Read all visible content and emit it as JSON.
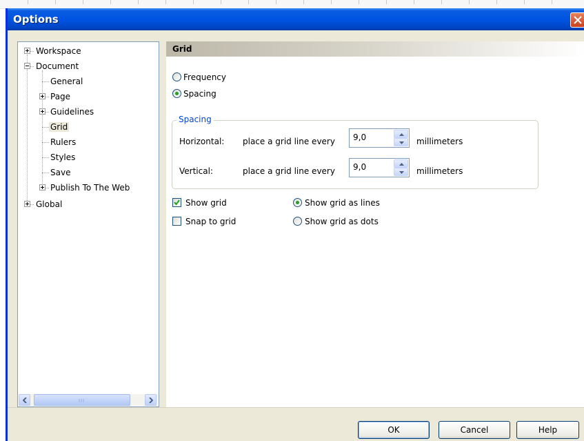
{
  "window": {
    "title": "Options",
    "close_icon": "close-icon"
  },
  "tree": {
    "items": [
      {
        "label": "Workspace",
        "expander": "plus"
      },
      {
        "label": "Document",
        "expander": "minus"
      },
      {
        "label": "General"
      },
      {
        "label": "Page",
        "expander": "plus"
      },
      {
        "label": "Guidelines",
        "expander": "plus"
      },
      {
        "label": "Grid",
        "selected": true
      },
      {
        "label": "Rulers"
      },
      {
        "label": "Styles"
      },
      {
        "label": "Save"
      },
      {
        "label": "Publish To The Web",
        "expander": "plus"
      },
      {
        "label": "Global",
        "expander": "plus"
      }
    ],
    "scrollbar_thumb_grip": "III"
  },
  "panel": {
    "header": "Grid",
    "mode_options": [
      {
        "label": "Frequency",
        "selected": false
      },
      {
        "label": "Spacing",
        "selected": true
      }
    ],
    "spacing_group": {
      "title": "Spacing",
      "rows": [
        {
          "axis": "Horizontal:",
          "text": "place a grid line every",
          "value": "9,0",
          "unit": "millimeters"
        },
        {
          "axis": "Vertical:",
          "text": "place a grid line every",
          "value": "9,0",
          "unit": "millimeters"
        }
      ]
    },
    "show_grid": {
      "label": "Show grid",
      "checked": true
    },
    "snap_to_grid": {
      "label": "Snap to grid",
      "checked": false
    },
    "display_options": [
      {
        "label": "Show grid as lines",
        "selected": true
      },
      {
        "label": "Show grid as dots",
        "selected": false
      }
    ]
  },
  "buttons": {
    "ok": "OK",
    "cancel": "Cancel",
    "help": "Help"
  },
  "colors": {
    "titlebar": "#0054e3",
    "dialog_bg": "#ece9d8",
    "group_title": "#0046d5",
    "radio_dot": "#21a121"
  }
}
